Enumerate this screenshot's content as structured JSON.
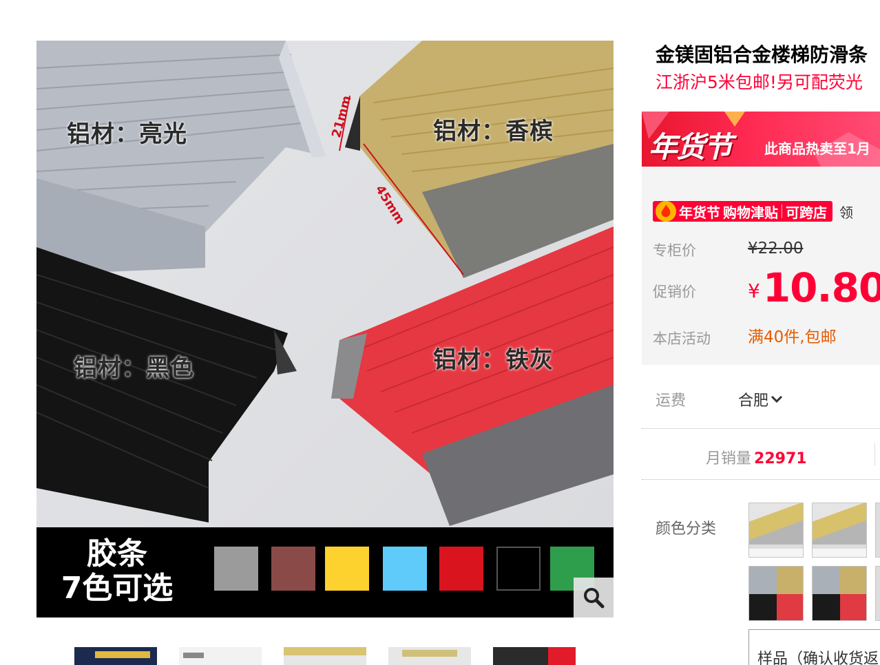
{
  "image": {
    "labels": {
      "bright": "铝材：亮光",
      "champagne": "铝材：香槟",
      "black": "铝材：黑色",
      "iron_gray": "铝材：铁灰"
    },
    "dims": {
      "height": "21mm",
      "width": "45mm"
    },
    "swatch_title_line1": "胶条",
    "swatch_title_line2": "7色可选",
    "swatch_colors": [
      "#9b9b9b",
      "#8a4a47",
      "#fdd22e",
      "#5ecbfb",
      "#d9141f",
      "#000000",
      "#2f9e4c"
    ]
  },
  "product": {
    "title": "金镁固铝合金楼梯防滑条",
    "subtitle": "江浙沪5米包邮!另可配荧光"
  },
  "promo": {
    "banner_logo": "年货节",
    "banner_text": "此商品热卖至1月",
    "subsidy_tag_1": "年货节",
    "subsidy_tag_2": "购物津贴",
    "subsidy_tag_3": "可跨店",
    "subsidy_extra": "领",
    "orig_label": "专柜价",
    "orig_price": "¥22.00",
    "promo_label": "促销价",
    "currency": "¥",
    "promo_price": "10.80",
    "activity_label": "本店活动",
    "activity_value": "满40件,包邮"
  },
  "shipping": {
    "label": "运费",
    "location": "合肥"
  },
  "sales": {
    "label": "月销量",
    "value": "22971"
  },
  "colors": {
    "label": "颜色分类",
    "sample_text": "样品（确认收货返"
  },
  "accent": "#ff0036"
}
